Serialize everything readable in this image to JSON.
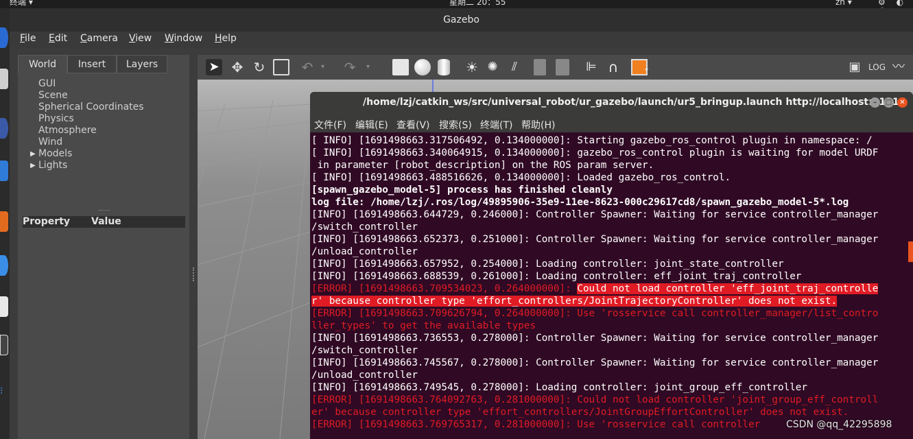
{
  "system_bar": {
    "app_menu": "终端 ▾",
    "clock": "星期二 20：55",
    "lang": "zh ▾",
    "tray": "⚙ ◐ ⚡"
  },
  "gazebo": {
    "title": "Gazebo",
    "menu": [
      "File",
      "Edit",
      "Camera",
      "View",
      "Window",
      "Help"
    ],
    "tabs": [
      "World",
      "Insert",
      "Layers"
    ],
    "tree": [
      "GUI",
      "Scene",
      "Spherical Coordinates",
      "Physics",
      "Atmosphere",
      "Wind",
      "Models",
      "Lights"
    ],
    "property_headers": {
      "property": "Property",
      "value": "Value"
    }
  },
  "terminal": {
    "title": "/home/lzj/catkin_ws/src/universal_robot/ur_gazebo/launch/ur5_bringup.launch http://localhost:11311",
    "menu": [
      "文件(F)",
      "编辑(E)",
      "查看(V)",
      "搜索(S)",
      "终端(T)",
      "帮助(H)"
    ],
    "lines": [
      {
        "text": "[ INFO] [1691498663.317506492, 0.134000000]: Starting gazebo_ros_control plugin in namespace: /",
        "style": "info"
      },
      {
        "text": "[ INFO] [1691498663.340064915, 0.134000000]: gazebo_ros_control plugin is waiting for model URDF",
        "style": "info"
      },
      {
        "text": " in parameter [robot_description] on the ROS param server.",
        "style": "info"
      },
      {
        "text": "[ INFO] [1691498663.488516626, 0.134000000]: Loaded gazebo_ros_control.",
        "style": "info"
      },
      {
        "text": "[spawn_gazebo_model-5] process has finished cleanly",
        "style": "bold"
      },
      {
        "text": "log file: /home/lzj/.ros/log/49895906-35e9-11ee-8623-000c29617cd8/spawn_gazebo_model-5*.log",
        "style": "bold"
      },
      {
        "text": "[INFO] [1691498663.644729, 0.246000]: Controller Spawner: Waiting for service controller_manager",
        "style": "info"
      },
      {
        "text": "/switch_controller",
        "style": "info"
      },
      {
        "text": "[INFO] [1691498663.652373, 0.251000]: Controller Spawner: Waiting for service controller_manager",
        "style": "info"
      },
      {
        "text": "/unload_controller",
        "style": "info"
      },
      {
        "text": "[INFO] [1691498663.657952, 0.254000]: Loading controller: joint_state_controller",
        "style": "info"
      },
      {
        "text": "[INFO] [1691498663.688539, 0.261000]: Loading controller: eff_joint_traj_controller",
        "style": "info"
      },
      {
        "text": "[ERROR] [1691498663.709534023, 0.264000000]: ",
        "highlight": "Could not load controller 'eff_joint_traj_controlle",
        "style": "err-hl"
      },
      {
        "text": "r' because controller type 'effort_controllers/JointTrajectoryController' does not exist.",
        "style": "err-full"
      },
      {
        "text": "[ERROR] [1691498663.709626794, 0.264000000]: Use 'rosservice call controller_manager/list_contro",
        "style": "err"
      },
      {
        "text": "ller_types' to get the available types",
        "style": "err"
      },
      {
        "text": "[INFO] [1691498663.736553, 0.278000]: Controller Spawner: Waiting for service controller_manager",
        "style": "info"
      },
      {
        "text": "/switch_controller",
        "style": "info"
      },
      {
        "text": "[INFO] [1691498663.745567, 0.278000]: Controller Spawner: Waiting for service controller_manager",
        "style": "info"
      },
      {
        "text": "/unload_controller",
        "style": "info"
      },
      {
        "text": "[INFO] [1691498663.749545, 0.278000]: Loading controller: joint_group_eff_controller",
        "style": "info"
      },
      {
        "text": "[ERROR] [1691498663.764092763, 0.281000000]: Could not load controller 'joint_group_eff_controll",
        "style": "err"
      },
      {
        "text": "er' because controller type 'effort_controllers/JointGroupEffortController' does not exist.",
        "style": "err"
      },
      {
        "text": "[ERROR] [1691498663.769765317, 0.281000000]: Use 'rosservice call controller",
        "style": "err"
      }
    ]
  },
  "watermark": "CSDN @qq_42295898",
  "colors": {
    "terminal_bg": "#300a24",
    "error": "#e01b24",
    "ubuntu_orange": "#e95420"
  }
}
